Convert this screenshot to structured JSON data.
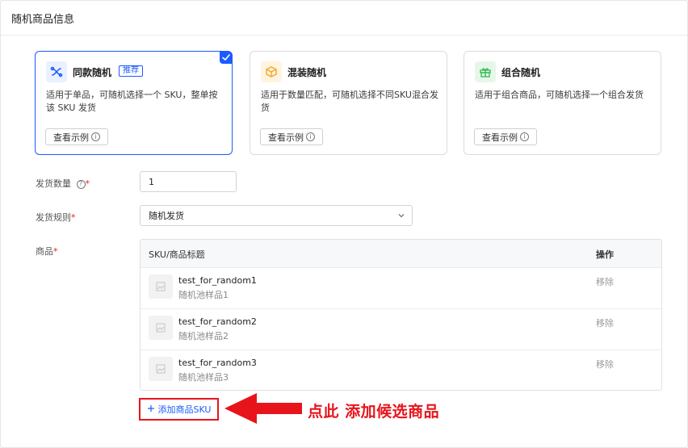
{
  "panel": {
    "title": "随机商品信息"
  },
  "cards": [
    {
      "title": "同款随机",
      "tag": "推荐",
      "desc": "适用于单品，可随机选择一个 SKU，整单按该 SKU 发货",
      "example_label": "查看示例",
      "selected": true,
      "icon": "shuffle-icon",
      "icon_color": "#1a5cff"
    },
    {
      "title": "混装随机",
      "desc": "适用于数量匹配，可随机选择不同SKU混合发货",
      "example_label": "查看示例",
      "selected": false,
      "icon": "box-icon",
      "icon_color": "#f5a623"
    },
    {
      "title": "组合随机",
      "desc": "适用于组合商品，可随机选择一个组合发货",
      "example_label": "查看示例",
      "selected": false,
      "icon": "gift-icon",
      "icon_color": "#2db94d"
    }
  ],
  "form": {
    "quantity": {
      "label": "发货数量",
      "value": "1"
    },
    "rule": {
      "label": "发货规则",
      "value": "随机发货"
    },
    "product": {
      "label": "商品"
    }
  },
  "table": {
    "headers": {
      "sku": "SKU/商品标题",
      "action": "操作"
    },
    "rows": [
      {
        "sku": "test_for_random1",
        "title": "随机池样品1",
        "action": "移除"
      },
      {
        "sku": "test_for_random2",
        "title": "随机池样品2",
        "action": "移除"
      },
      {
        "sku": "test_for_random3",
        "title": "随机池样品3",
        "action": "移除"
      }
    ]
  },
  "add_button": {
    "label": "添加商品SKU"
  },
  "annotation": {
    "text": "点此 添加候选商品",
    "color": "#e8141b"
  },
  "colors": {
    "accent": "#1a5cff",
    "required": "#e02020"
  }
}
